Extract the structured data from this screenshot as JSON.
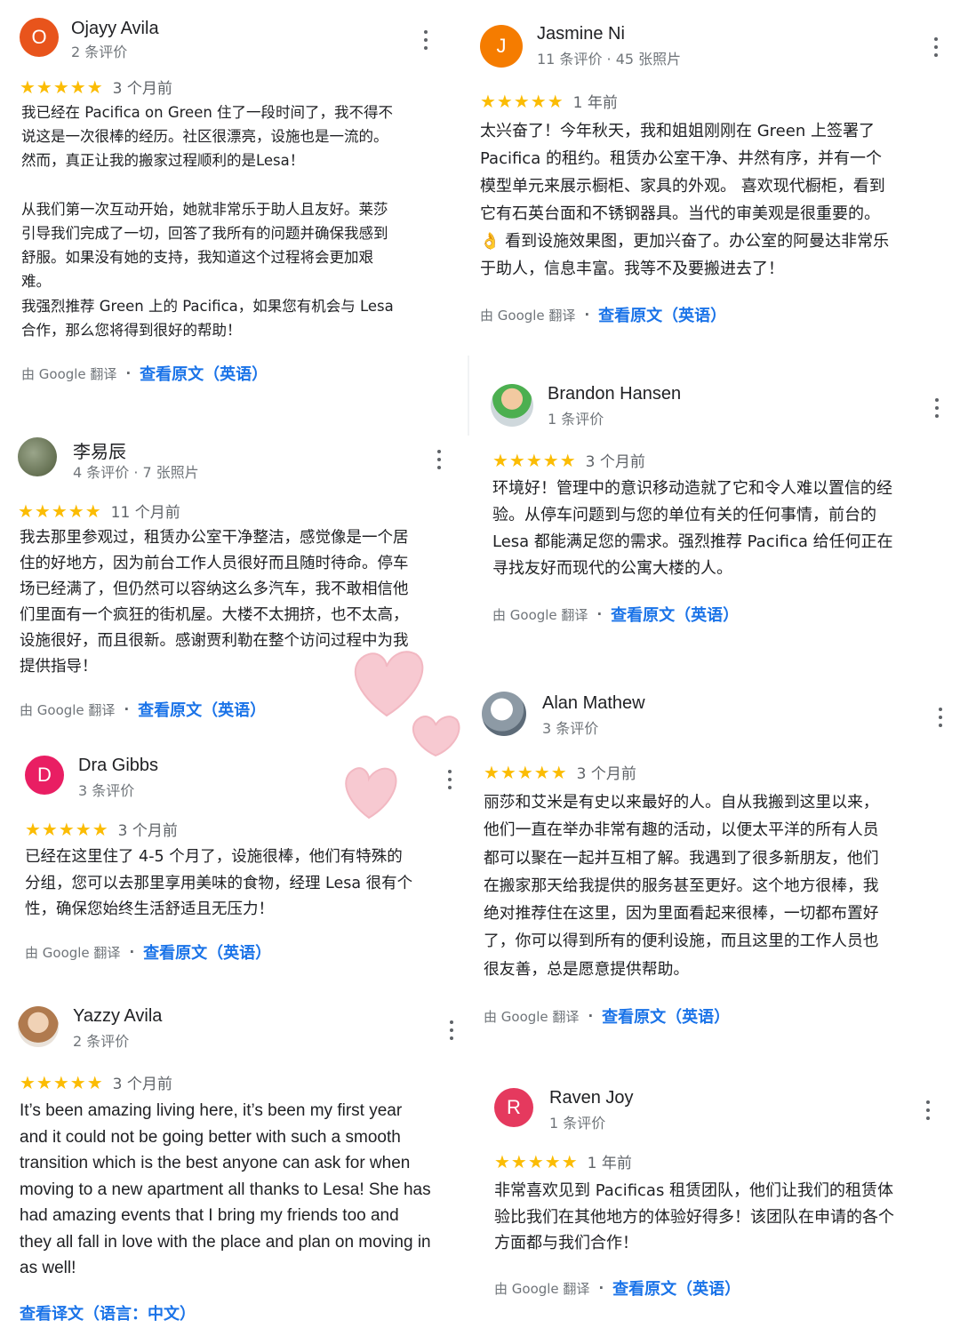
{
  "colors": {
    "star": "#fbbc04",
    "link": "#1a73e8",
    "meta": "#70757a",
    "heart": "#f2b8c2"
  },
  "icons": {
    "star": "star-icon",
    "more": "more-vert-icon",
    "heart": "heart-decoration"
  },
  "reviews": [
    {
      "avatar_letter": "O",
      "avatar_color": "#e8541c",
      "name": "Ojayy Avila",
      "meta": "2 条评价",
      "stars": "★★★★★",
      "time": "3 个月前",
      "text": "我已经在 Pacifica on Green 住了一段时间了，我不得不\n说这是一次很棒的经历。社区很漂亮，设施也是一流的。\n然而，真正让我的搬家过程顺利的是Lesa！\n\n从我们第一次互动开始，她就非常乐于助人且友好。莱莎\n引导我们完成了一切，回答了我所有的问题并确保我感到\n舒服。如果没有她的支持，我知道这个过程将会更加艰\n难。\n我强烈推荐 Green 上的 Pacifica，如果您有机会与 Lesa\n合作，那么您将得到很好的帮助！",
      "translated_by": "由 Google 翻译",
      "link": "查看原文（英语）"
    },
    {
      "avatar_letter": "J",
      "avatar_color": "#f57c00",
      "name": "Jasmine Ni",
      "meta": "11 条评价 · 45 张照片",
      "stars": "★★★★★",
      "time": "1 年前",
      "text": "太兴奋了！今年秋天，我和姐姐刚刚在 Green 上签署了\nPacifica 的租约。租赁办公室干净、井然有序，并有一个\n模型单元来展示橱柜、家具的外观。 喜欢现代橱柜，看到\n它有石英台面和不锈钢器具。当代的审美观是很重要的。\n👌 看到设施效果图，更加兴奋了。办公室的阿曼达非常乐\n于助人，信息丰富。我等不及要搬进去了！",
      "translated_by": "由 Google 翻译",
      "link": "查看原文（英语）"
    },
    {
      "avatar_letter": "",
      "avatar_color": "#6d7b5a",
      "name": "李易辰",
      "meta": "4 条评价 · 7 张照片",
      "stars": "★★★★★",
      "time": "11 个月前",
      "text": "我去那里参观过，租赁办公室干净整洁，感觉像是一个居\n住的好地方，因为前台工作人员很好而且随时待命。停车\n场已经满了，但仍然可以容纳这么多汽车，我不敢相信他\n们里面有一个疯狂的街机屋。大楼不太拥挤，也不太高，\n设施很好，而且很新。感谢贾利勒在整个访问过程中为我\n提供指导！",
      "translated_by": "由 Google 翻译",
      "link": "查看原文（英语）"
    },
    {
      "avatar_letter": "",
      "avatar_color": "#4caf50",
      "name": "Brandon Hansen",
      "meta": "1 条评价",
      "stars": "★★★★★",
      "time": "3 个月前",
      "text": "环境好！管理中的意识移动造就了它和令人难以置信的经\n验。从停车问题到与您的单位有关的任何事情，前台的\nLesa 都能满足您的需求。强烈推荐 Pacifica 给任何正在\n寻找友好而现代的公寓大楼的人。",
      "translated_by": "由 Google 翻译",
      "link": "查看原文（英语）"
    },
    {
      "avatar_letter": "D",
      "avatar_color": "#e91e63",
      "name": "Dra Gibbs",
      "meta": "3 条评价",
      "stars": "★★★★★",
      "time": "3 个月前",
      "text": "已经在这里住了 4-5 个月了，设施很棒，他们有特殊的\n分组，您可以去那里享用美味的食物，经理 Lesa 很有个\n性，确保您始终生活舒适且无压力！",
      "translated_by": "由 Google 翻译",
      "link": "查看原文（英语）"
    },
    {
      "avatar_letter": "",
      "avatar_color": "#8d9aa5",
      "name": "Alan Mathew",
      "meta": "3 条评价",
      "stars": "★★★★★",
      "time": "3 个月前",
      "text": "丽莎和艾米是有史以来最好的人。自从我搬到这里以来，\n他们一直在举办非常有趣的活动，以便太平洋的所有人员\n都可以聚在一起并互相了解。我遇到了很多新朋友，他们\n在搬家那天给我提供的服务甚至更好。这个地方很棒，我\n绝对推荐住在这里，因为里面看起来很棒，一切都布置好\n了，你可以得到所有的便利设施，而且这里的工作人员也\n很友善，总是愿意提供帮助。",
      "translated_by": "由 Google 翻译",
      "link": "查看原文（英语）"
    },
    {
      "avatar_letter": "",
      "avatar_color": "#c9a27e",
      "name": "Yazzy Avila",
      "meta": "2 条评价",
      "stars": "★★★★★",
      "time": "3 个月前",
      "text": "It’s been amazing living here, it’s been my first year\nand it could not be going better with such a smooth\ntransition which is the best anyone can ask for when\nmoving to a new apartment all thanks to Lesa! She has\nhad amazing events that I bring my friends too and\nthey all fall in love with the place and plan on moving in\nas well!",
      "link": "查看译文（语言：中文）"
    },
    {
      "avatar_letter": "R",
      "avatar_color": "#e5395e",
      "name": "Raven Joy",
      "meta": "1 条评价",
      "stars": "★★★★★",
      "time": "1 年前",
      "text": "非常喜欢见到 Pacificas 租赁团队，他们让我们的租赁体\n验比我们在其他地方的体验好得多！该团队在申请的各个\n方面都与我们合作！",
      "translated_by": "由 Google 翻译",
      "link": "查看原文（英语）"
    }
  ]
}
